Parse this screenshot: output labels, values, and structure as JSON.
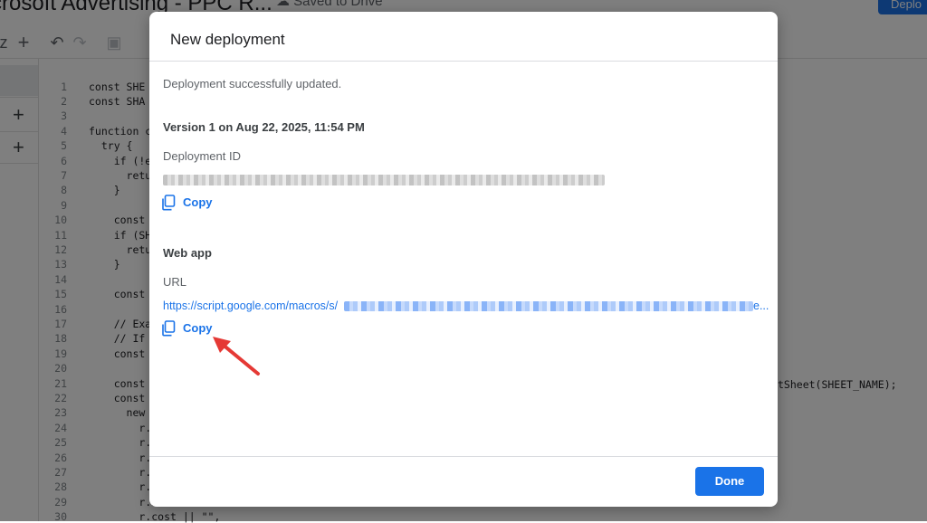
{
  "app": {
    "title": "crosoft Advertising - PPC R...",
    "saved_status": "Saved to Drive",
    "deploy_label": "Deplo"
  },
  "editor": {
    "line_numbers": [
      "1",
      "2",
      "3",
      "4",
      "5",
      "6",
      "7",
      "8",
      "9",
      "10",
      "11",
      "12",
      "13",
      "14",
      "15",
      "16",
      "17",
      "18",
      "19",
      "20",
      "21",
      "22",
      "23",
      "24",
      "25",
      "26",
      "27",
      "28",
      "29",
      "30"
    ],
    "lines": {
      "l1": "const SHE",
      "l2": "const SHA",
      "l4": "function c",
      "l5": "  try {",
      "l6": "    if (!e",
      "l7": "      retu",
      "l8": "    }",
      "l10": "    const",
      "l11": "    if (SH",
      "l12": "      retu",
      "l13": "    }",
      "l15": "    const",
      "l17": "    // Exa",
      "l18": "    // If",
      "l19": "    const",
      "l21": "    const",
      "l22": "    const",
      "l23": "      new",
      "l24": "        r.a",
      "l25": "        r.a",
      "l26": "        r.d",
      "l27": "        r.c",
      "l28": "        r.c",
      "l29": "        r.i",
      "l30": "        r.cost || \"\","
    },
    "right_fragment": "tSheet(SHEET_NAME);"
  },
  "dialog": {
    "title": "New deployment",
    "status": "Deployment successfully updated.",
    "version": "Version 1 on Aug 22, 2025, 11:54 PM",
    "deployment_id_label": "Deployment ID",
    "copy_label": "Copy",
    "web_app_label": "Web app",
    "url_label": "URL",
    "url_prefix": "https://script.google.com/macros/s/",
    "url_ellipsis": "e...",
    "done_label": "Done"
  },
  "colors": {
    "accent": "#1a73e8",
    "annotation_arrow": "#e53935",
    "overlay": "rgba(0,0,0,0.5)"
  },
  "icons": [
    "copy-icon",
    "plus-icon",
    "undo-icon",
    "redo-icon",
    "save-icon"
  ]
}
